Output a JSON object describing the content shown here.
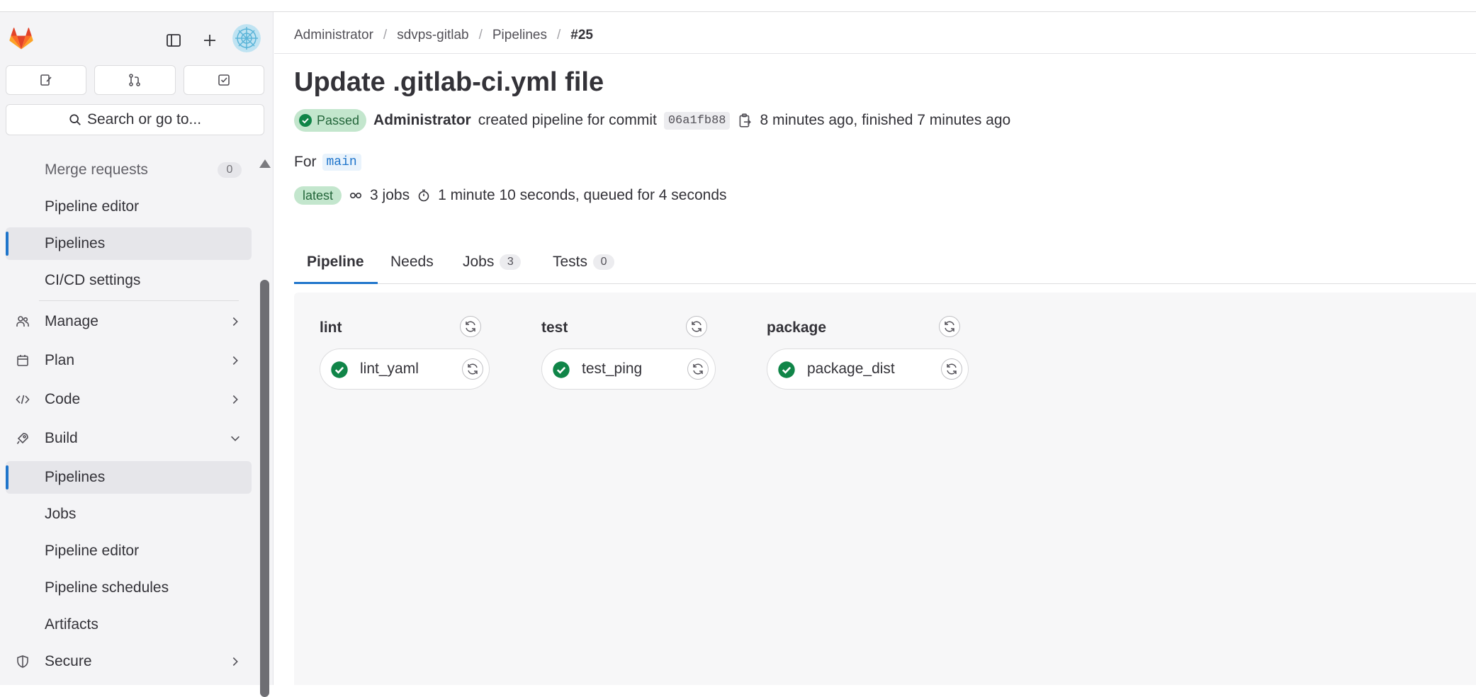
{
  "colors": {
    "accent": "#1f75cb",
    "success": "#108548",
    "success_bg": "#c3e6cd",
    "logo_orange": "#e24329"
  },
  "sidebar": {
    "search_label": "Search or go to...",
    "items": [
      {
        "label": "Merge requests",
        "count": "0"
      },
      {
        "label": "Pipeline editor"
      },
      {
        "label": "Pipelines",
        "active": true
      },
      {
        "label": "CI/CD settings"
      },
      {
        "label": "Manage",
        "icon": "users-icon"
      },
      {
        "label": "Plan",
        "icon": "calendar-icon"
      },
      {
        "label": "Code",
        "icon": "code-icon"
      },
      {
        "label": "Build",
        "icon": "rocket-icon"
      },
      {
        "label": "Pipelines",
        "active": true
      },
      {
        "label": "Jobs"
      },
      {
        "label": "Pipeline editor"
      },
      {
        "label": "Pipeline schedules"
      },
      {
        "label": "Artifacts"
      },
      {
        "label": "Secure",
        "icon": "shield-icon"
      }
    ]
  },
  "breadcrumb": [
    "Administrator",
    "sdvps-gitlab",
    "Pipelines",
    "#25"
  ],
  "pipeline": {
    "title": "Update .gitlab-ci.yml file",
    "status": "Passed",
    "author": "Administrator",
    "created_text": "created pipeline for commit",
    "commit_sha": "06a1fb88",
    "time_text": "8 minutes ago, finished 7 minutes ago",
    "for_label": "For",
    "ref": "main",
    "latest_badge": "latest",
    "jobs_count_text": "3 jobs",
    "duration_text": "1 minute 10 seconds, queued for 4 seconds"
  },
  "tabs": [
    {
      "label": "Pipeline",
      "active": true
    },
    {
      "label": "Needs"
    },
    {
      "label": "Jobs",
      "count": "3"
    },
    {
      "label": "Tests",
      "count": "0"
    }
  ],
  "stages": [
    {
      "name": "lint",
      "jobs": [
        "lint_yaml"
      ]
    },
    {
      "name": "test",
      "jobs": [
        "test_ping"
      ]
    },
    {
      "name": "package",
      "jobs": [
        "package_dist"
      ]
    }
  ]
}
